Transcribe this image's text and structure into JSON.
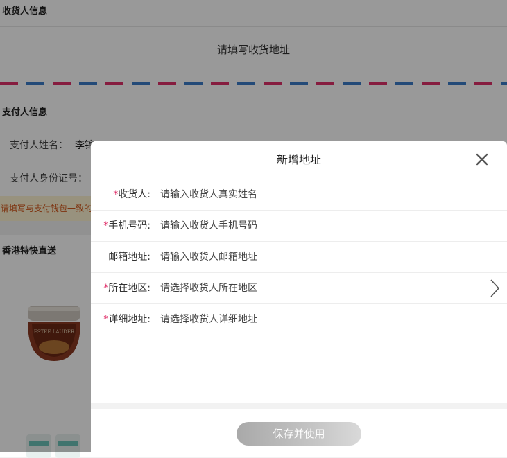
{
  "consignee_section": {
    "title": "收货人信息",
    "prompt": "请填写收货地址"
  },
  "payer_section": {
    "title": "支付人信息",
    "name_label": "支付人姓名：",
    "name_value": "李锦",
    "id_label": "支付人身份证号："
  },
  "notice": {
    "text": "请填写与支付钱包一致的"
  },
  "shipping_section": {
    "title": "香港特快直送"
  },
  "products": [
    {
      "brand": "ESTEE LAUDER"
    },
    {
      "brand": ""
    }
  ],
  "modal": {
    "title": "新增地址",
    "close_icon": "close-icon",
    "fields": [
      {
        "required": "*",
        "label": "收货人:",
        "placeholder": "请输入收货人真实姓名",
        "type": "input"
      },
      {
        "required": "*",
        "label": "手机号码:",
        "placeholder": "请输入收货人手机号码",
        "type": "input"
      },
      {
        "required": "",
        "label": "邮箱地址:",
        "placeholder": "请输入收货人邮箱地址",
        "type": "input"
      },
      {
        "required": "*",
        "label": "所在地区:",
        "placeholder": "请选择收货人所在地区",
        "type": "select",
        "icon": "chevron-right-icon"
      },
      {
        "required": "*",
        "label": "详细地址:",
        "placeholder": "请选择收货人详细地址",
        "type": "input"
      }
    ],
    "save_label": "保存并使用"
  },
  "colors": {
    "required_mark": "#e0306a",
    "stripe_pink": "#e0306a",
    "stripe_blue": "#3b7cc9",
    "notice_text": "#d2561a",
    "notice_bg": "#fdf4d2",
    "overlay": "rgba(0,0,0,0.40)"
  }
}
